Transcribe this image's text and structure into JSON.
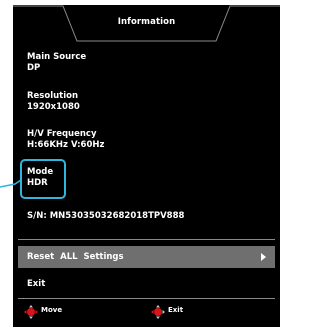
{
  "header": {
    "title": "Information"
  },
  "info": {
    "main_source_label": "Main Source",
    "main_source_value": "DP",
    "resolution_label": "Resolution",
    "resolution_value": "1920x1080",
    "frequency_label": "H/V Frequency",
    "frequency_value": "H:66KHz  V:60Hz",
    "mode_label": "Mode",
    "mode_value": "HDR",
    "serial": "S/N: MN53035032682018TPV888"
  },
  "menu": {
    "reset_label": "Reset  ALL  Settings",
    "exit_label": "Exit"
  },
  "footer": {
    "move_label": "Move",
    "exit_label": "Exit"
  },
  "colors": {
    "background": "#000000",
    "highlight_row": "#6f6f6f",
    "mode_highlight": "#2fb6df",
    "nav_dpad": "#d7141a"
  },
  "icons": {
    "move": "dpad-left-right-icon",
    "exit": "dpad-left-icon",
    "reset_arrow": "chevron-right-icon"
  }
}
